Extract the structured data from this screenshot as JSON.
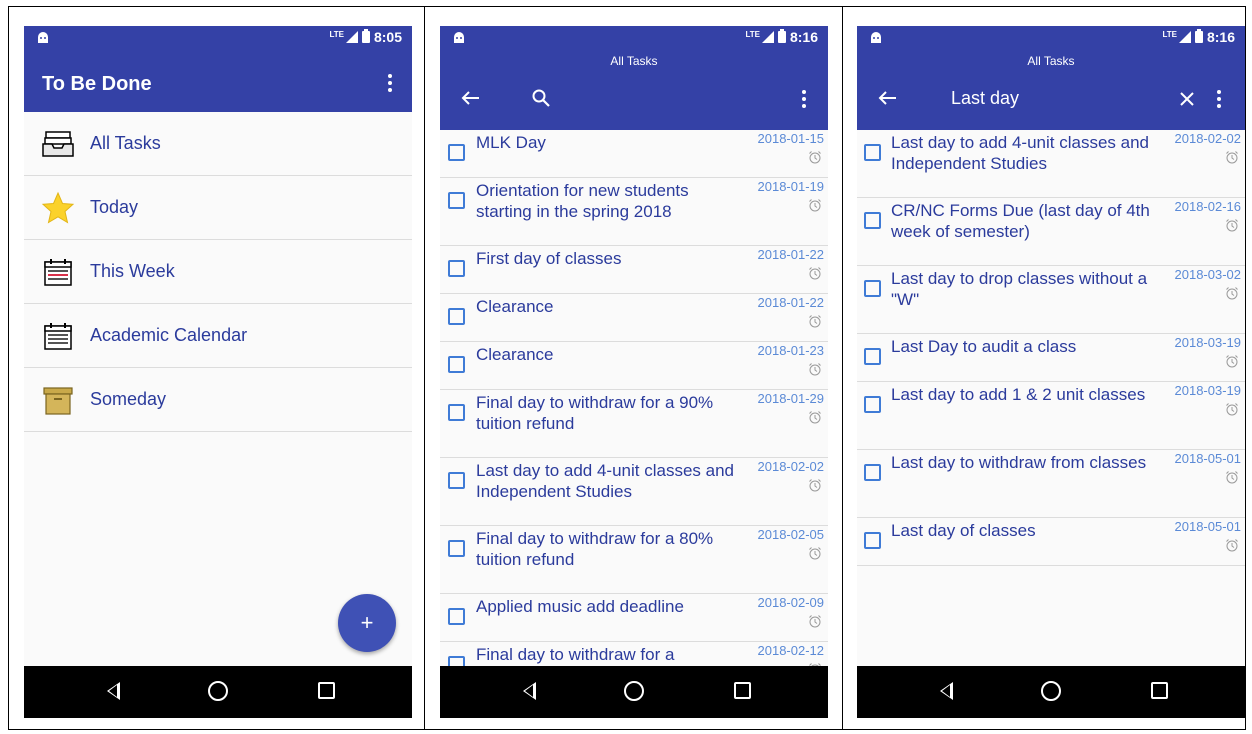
{
  "screens": [
    {
      "status_time": "8:05",
      "status_network": "LTE",
      "title": "To Be Done",
      "nav_items": [
        {
          "label": "All Tasks",
          "icon": "inbox-icon"
        },
        {
          "label": "Today",
          "icon": "star-icon"
        },
        {
          "label": "This Week",
          "icon": "calendar-week-icon"
        },
        {
          "label": "Academic Calendar",
          "icon": "calendar-icon"
        },
        {
          "label": "Someday",
          "icon": "archive-box-icon"
        }
      ],
      "fab_label": "+"
    },
    {
      "status_time": "8:16",
      "status_network": "LTE",
      "subtitle": "All Tasks",
      "tasks": [
        {
          "title": "MLK Day",
          "date": "2018-01-15"
        },
        {
          "title": "Orientation for new students starting in the spring 2018",
          "date": "2018-01-19"
        },
        {
          "title": "First day of classes",
          "date": "2018-01-22"
        },
        {
          "title": "Clearance",
          "date": "2018-01-22"
        },
        {
          "title": "Clearance",
          "date": "2018-01-23"
        },
        {
          "title": "Final day to withdraw for a 90% tuition refund",
          "date": "2018-01-29"
        },
        {
          "title": "Last day to add 4-unit classes and Independent Studies",
          "date": "2018-02-02"
        },
        {
          "title": "Final day to withdraw for a 80% tuition refund",
          "date": "2018-02-05"
        },
        {
          "title": "Applied music add deadline",
          "date": "2018-02-09"
        },
        {
          "title": "Final day to withdraw for a",
          "date": "2018-02-12"
        }
      ]
    },
    {
      "status_time": "8:16",
      "status_network": "LTE",
      "subtitle": "All Tasks",
      "search_query": "Last day",
      "tasks": [
        {
          "title": "Last day to add 4-unit classes and Independent Studies",
          "date": "2018-02-02"
        },
        {
          "title": "CR/NC Forms Due (last day of 4th week of semester)",
          "date": "2018-02-16"
        },
        {
          "title": "Last day to drop classes without a \"W\"",
          "date": "2018-03-02"
        },
        {
          "title": "Last Day to audit a class",
          "date": "2018-03-19"
        },
        {
          "title": "Last day to add 1 & 2 unit classes",
          "date": "2018-03-19"
        },
        {
          "title": "Last day to withdraw from classes",
          "date": "2018-05-01"
        },
        {
          "title": "Last day of classes",
          "date": "2018-05-01"
        }
      ]
    }
  ],
  "colors": {
    "appbar": "#3441a6",
    "accent": "#3f51b5",
    "task_text": "#2b3b9c",
    "date_text": "#5b8ad6"
  }
}
